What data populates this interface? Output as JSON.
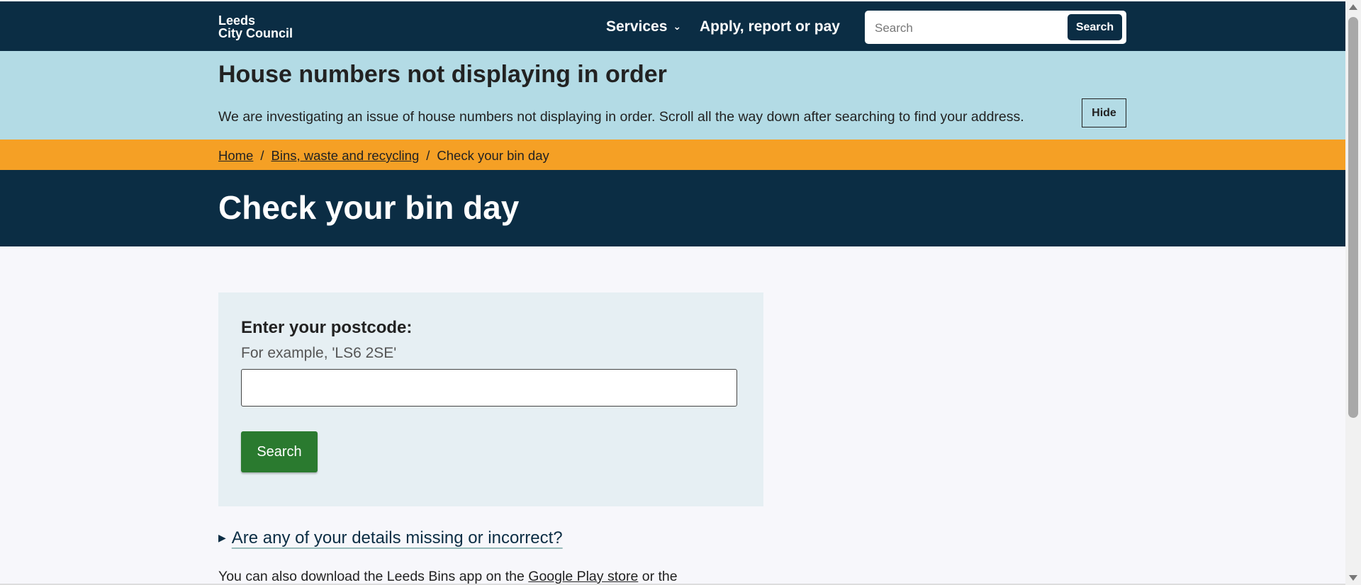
{
  "header": {
    "logo_line1": "Leeds",
    "logo_line2": "City Council",
    "nav_services": "Services",
    "nav_apply": "Apply, report or pay",
    "search_placeholder": "Search",
    "search_button": "Search"
  },
  "alert": {
    "title": "House numbers not displaying in order",
    "body": "We are investigating an issue of house numbers not displaying in order. Scroll all the way down after searching to find your address.",
    "hide_button": "Hide"
  },
  "breadcrumb": {
    "home": "Home",
    "bins": "Bins, waste and recycling",
    "current": "Check your bin day",
    "separator": "/"
  },
  "main": {
    "page_title": "Check your bin day",
    "postcode_label": "Enter your postcode:",
    "postcode_hint": "For example, 'LS6 2SE'",
    "postcode_value": "",
    "search_button": "Search",
    "details_summary": "Are any of your details missing or incorrect?",
    "app_text_prefix": "You can also download the Leeds Bins app on the",
    "app_link": "Google Play store",
    "app_text_suffix": "or the"
  },
  "colors": {
    "navy": "#0b2d44",
    "alert_blue": "#b3dbe5",
    "breadcrumb_orange": "#f5a025",
    "button_green": "#2a7a2f"
  }
}
